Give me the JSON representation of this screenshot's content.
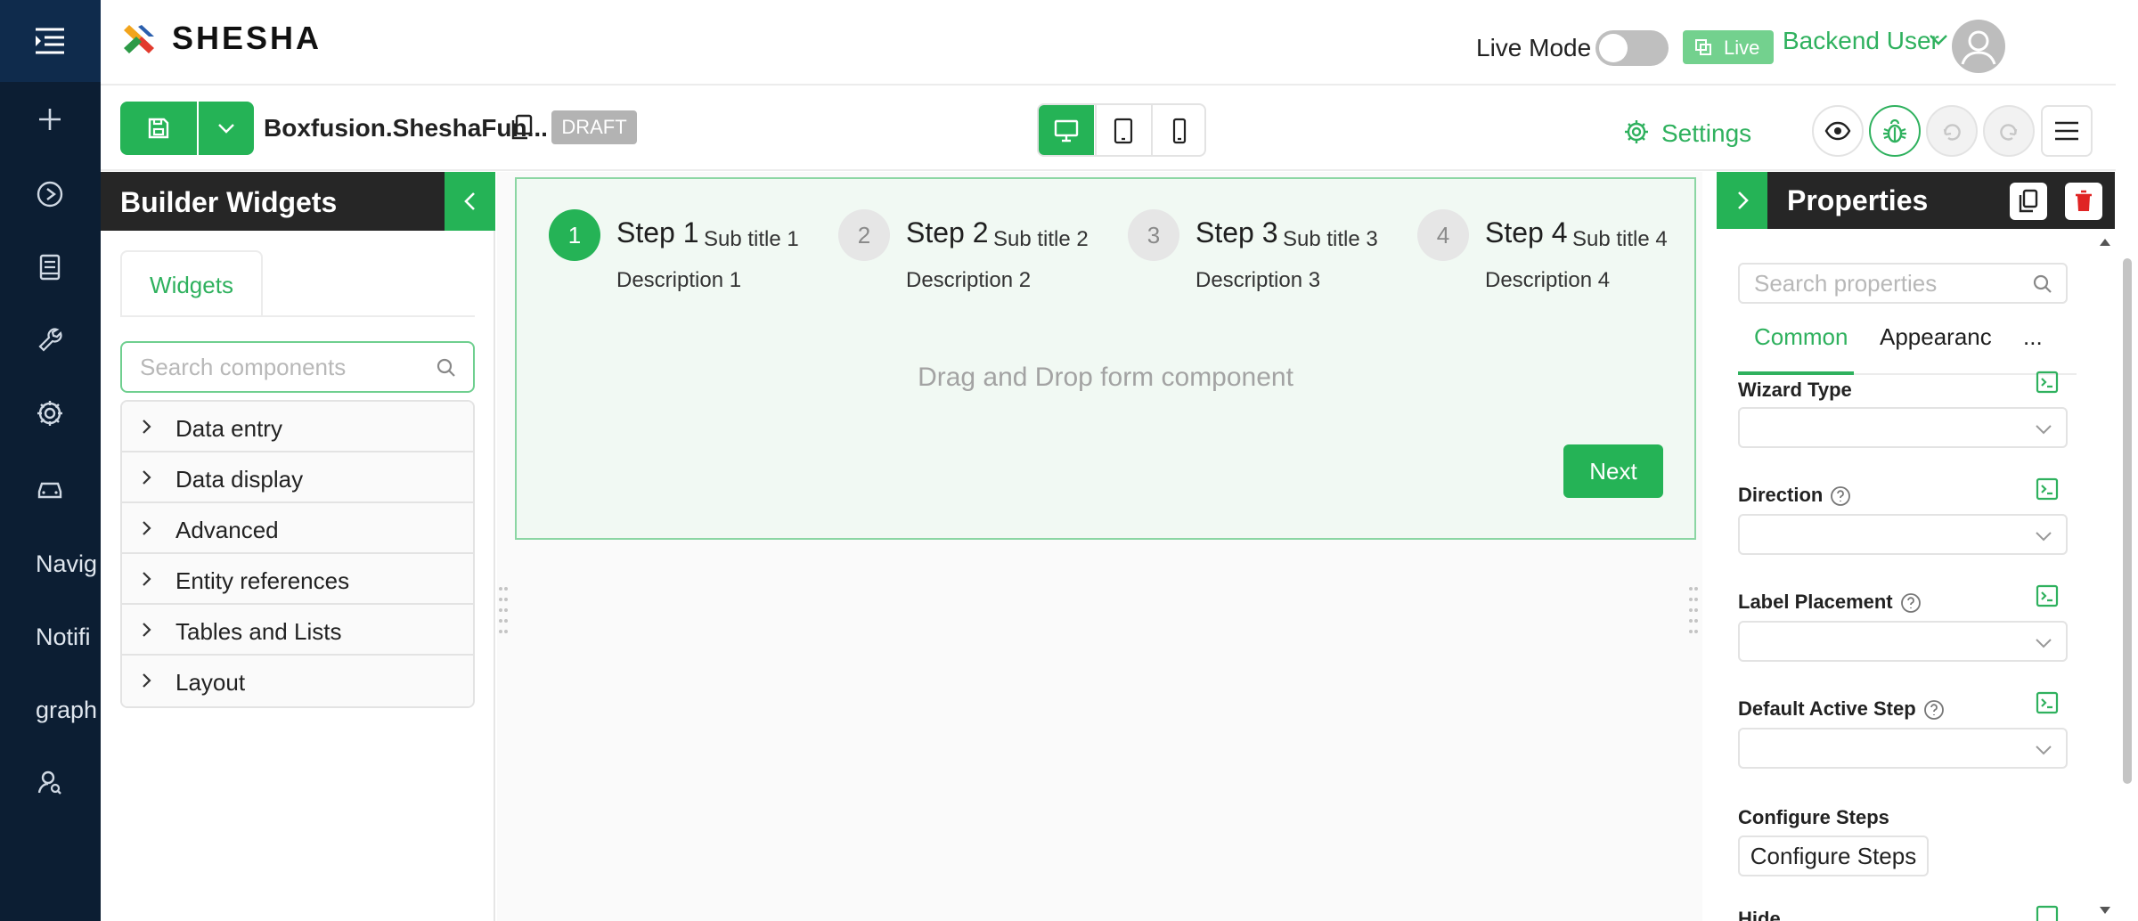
{
  "nav": {
    "items": [
      {
        "icon": "plus-icon"
      },
      {
        "icon": "play-circle-icon"
      },
      {
        "icon": "book-icon"
      },
      {
        "icon": "wrench-icon"
      },
      {
        "icon": "gear-icon"
      },
      {
        "icon": "car-icon"
      }
    ],
    "labels": [
      "Navig",
      "Notifi",
      "graph"
    ],
    "bottom_icon": "user-search-icon"
  },
  "header": {
    "logo_text": "SHESHA",
    "live_mode_label": "Live Mode",
    "live_badge": "Live",
    "user_name": "Backend User"
  },
  "toolbar": {
    "form_name": "Boxfusion.SheshaFun...",
    "status": "DRAFT",
    "settings_label": "Settings"
  },
  "widgets": {
    "title": "Builder Widgets",
    "tab": "Widgets",
    "search_placeholder": "Search components",
    "categories": [
      "Data entry",
      "Data display",
      "Advanced",
      "Entity references",
      "Tables and Lists",
      "Layout"
    ]
  },
  "wizard": {
    "steps": [
      {
        "num": "1",
        "title": "Step 1",
        "subtitle": "Sub title 1",
        "description": "Description 1"
      },
      {
        "num": "2",
        "title": "Step 2",
        "subtitle": "Sub title 2",
        "description": "Description 2"
      },
      {
        "num": "3",
        "title": "Step 3",
        "subtitle": "Sub title 3",
        "description": "Description 3"
      },
      {
        "num": "4",
        "title": "Step 4",
        "subtitle": "Sub title 4",
        "description": "Description 4"
      }
    ],
    "drop_hint": "Drag and Drop form component",
    "next_label": "Next"
  },
  "properties": {
    "title": "Properties",
    "search_placeholder": "Search properties",
    "tabs": [
      "Common",
      "Appearanc",
      "..."
    ],
    "fields": [
      "Wizard Type",
      "Direction",
      "Label Placement",
      "Default Active Step"
    ],
    "configure_label": "Configure Steps",
    "configure_button": "Configure Steps",
    "next_field_partial": "Hide"
  },
  "colors": {
    "nav_bg": "#0c1e33",
    "accent": "#25b356",
    "accent_text": "#2fb15e",
    "panel_head": "#262626",
    "delete": "#e02424"
  }
}
